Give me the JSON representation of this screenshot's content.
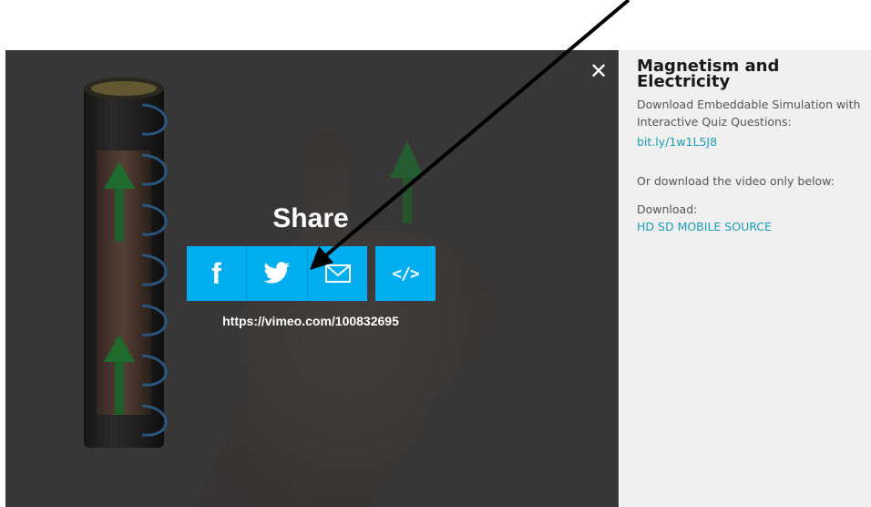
{
  "share": {
    "title": "Share",
    "url": "https://vimeo.com/100832695",
    "close_glyph": "✕",
    "facebook_glyph": "f",
    "embed_glyph": "</>",
    "button_color": "#00adef"
  },
  "sidebar": {
    "title": "Magnetism and Electricity",
    "description": "Download Embeddable Simulation with Interactive Quiz Questions:",
    "short_link": "bit.ly/1w1L5J8",
    "video_only_text": "Or download the video only below:",
    "download_label": "Download:",
    "download_links": [
      "HD",
      "SD",
      "MOBILE",
      "SOURCE"
    ],
    "link_color": "#1b9bb5"
  },
  "annotation": {
    "arrow_color": "#000000"
  }
}
